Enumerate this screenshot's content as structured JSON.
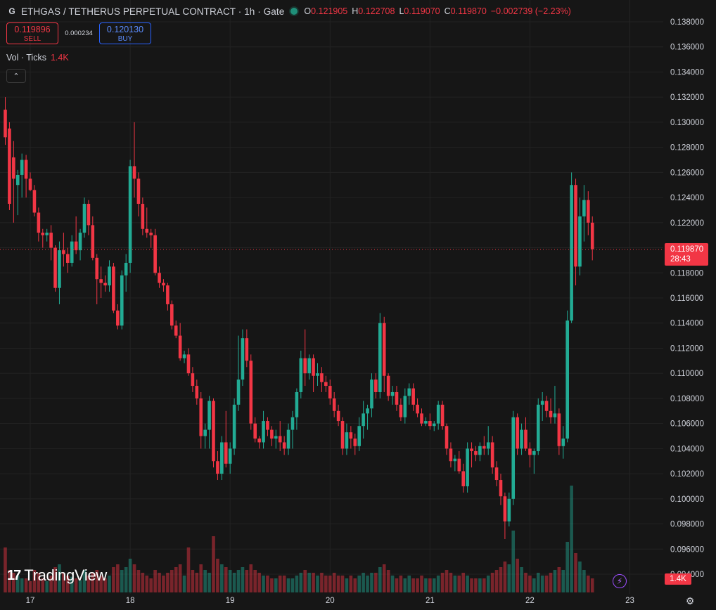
{
  "header": {
    "symbol_logo": "G",
    "title": "ETHGAS / TETHERUS PERPETUAL CONTRACT · 1h · Gate",
    "open_label": "O",
    "open": "0.121905",
    "high_label": "H",
    "high": "0.122708",
    "low_label": "L",
    "low": "0.119070",
    "close_label": "C",
    "close": "0.119870",
    "change": "−0.002739 (−2.23%)"
  },
  "trade": {
    "sell_price": "0.119896",
    "sell_label": "SELL",
    "spread": "0.000234",
    "buy_price": "0.120130",
    "buy_label": "BUY"
  },
  "volume_legend": {
    "label": "Vol · Ticks",
    "value": "1.4K"
  },
  "last_price_tag": {
    "price": "0.119870",
    "countdown": "28:43"
  },
  "volume_tag": "1.4K",
  "watermark": "TradingView",
  "colors": {
    "up": "#22ab94",
    "down": "#f23645",
    "background": "#161616",
    "grid": "#232323"
  },
  "icons": [
    "chevron-up-icon",
    "lightning-icon",
    "settings-icon",
    "tradingview-logo-icon"
  ],
  "chart_data": {
    "type": "candlestick",
    "title": "ETHGAS / TETHERUS PERPETUAL CONTRACT · 1h · Gate",
    "y_ticks": [
      "0.138000",
      "0.136000",
      "0.134000",
      "0.132000",
      "0.130000",
      "0.128000",
      "0.126000",
      "0.124000",
      "0.122000",
      "0.120000",
      "0.118000",
      "0.116000",
      "0.114000",
      "0.112000",
      "0.110000",
      "0.108000",
      "0.106000",
      "0.104000",
      "0.102000",
      "0.100000",
      "0.098000",
      "0.096000",
      "0.094000"
    ],
    "x_ticks": [
      {
        "label": "17",
        "bar": 6
      },
      {
        "label": "18",
        "bar": 30
      },
      {
        "label": "19",
        "bar": 54
      },
      {
        "label": "20",
        "bar": 78
      },
      {
        "label": "21",
        "bar": 102
      },
      {
        "label": "22",
        "bar": 126
      },
      {
        "label": "23",
        "bar": 150
      }
    ],
    "ylim": [
      0.0935,
      0.139
    ],
    "last_price": 0.11987,
    "candles": [
      [
        0.131,
        0.132,
        0.1282,
        0.1288,
        80
      ],
      [
        0.1295,
        0.13,
        0.123,
        0.1235,
        40
      ],
      [
        0.1272,
        0.1285,
        0.122,
        0.1255,
        35
      ],
      [
        0.125,
        0.1262,
        0.1226,
        0.1258,
        30
      ],
      [
        0.1258,
        0.1275,
        0.124,
        0.127,
        25
      ],
      [
        0.127,
        0.1274,
        0.124,
        0.1255,
        25
      ],
      [
        0.1255,
        0.126,
        0.1245,
        0.1246,
        20
      ],
      [
        0.1246,
        0.125,
        0.1225,
        0.1228,
        40
      ],
      [
        0.1228,
        0.1232,
        0.1205,
        0.1212,
        35
      ],
      [
        0.1212,
        0.1215,
        0.12,
        0.121,
        25
      ],
      [
        0.121,
        0.1215,
        0.1205,
        0.1212,
        20
      ],
      [
        0.1212,
        0.1218,
        0.119,
        0.12,
        30
      ],
      [
        0.12,
        0.1202,
        0.1165,
        0.1168,
        45
      ],
      [
        0.1168,
        0.1205,
        0.1155,
        0.1198,
        50
      ],
      [
        0.1198,
        0.1212,
        0.1185,
        0.1195,
        35
      ],
      [
        0.1195,
        0.12,
        0.118,
        0.1188,
        30
      ],
      [
        0.1188,
        0.121,
        0.1185,
        0.1205,
        28
      ],
      [
        0.1205,
        0.1225,
        0.1195,
        0.1198,
        25
      ],
      [
        0.1198,
        0.1215,
        0.119,
        0.1212,
        22
      ],
      [
        0.1212,
        0.124,
        0.1208,
        0.1235,
        40
      ],
      [
        0.1235,
        0.1238,
        0.121,
        0.1218,
        30
      ],
      [
        0.1218,
        0.1225,
        0.119,
        0.1192,
        35
      ],
      [
        0.1192,
        0.1195,
        0.1155,
        0.1175,
        40
      ],
      [
        0.1175,
        0.1185,
        0.116,
        0.1172,
        30
      ],
      [
        0.1172,
        0.1178,
        0.1165,
        0.117,
        25
      ],
      [
        0.117,
        0.119,
        0.1165,
        0.1185,
        30
      ],
      [
        0.1185,
        0.1188,
        0.1148,
        0.115,
        45
      ],
      [
        0.115,
        0.1155,
        0.1135,
        0.1138,
        50
      ],
      [
        0.1138,
        0.1182,
        0.1135,
        0.1178,
        40
      ],
      [
        0.1178,
        0.1195,
        0.1165,
        0.1188,
        45
      ],
      [
        0.1188,
        0.127,
        0.118,
        0.1265,
        60
      ],
      [
        0.1265,
        0.13,
        0.124,
        0.1255,
        50
      ],
      [
        0.1255,
        0.126,
        0.1225,
        0.1235,
        40
      ],
      [
        0.1235,
        0.124,
        0.121,
        0.1215,
        35
      ],
      [
        0.1215,
        0.1232,
        0.1208,
        0.1212,
        30
      ],
      [
        0.1212,
        0.1215,
        0.12,
        0.121,
        25
      ],
      [
        0.121,
        0.1215,
        0.1178,
        0.118,
        40
      ],
      [
        0.118,
        0.1185,
        0.1168,
        0.1172,
        35
      ],
      [
        0.1172,
        0.1175,
        0.1165,
        0.117,
        30
      ],
      [
        0.117,
        0.1172,
        0.115,
        0.1155,
        35
      ],
      [
        0.1155,
        0.1158,
        0.1135,
        0.1138,
        40
      ],
      [
        0.1138,
        0.1142,
        0.1128,
        0.113,
        45
      ],
      [
        0.113,
        0.114,
        0.111,
        0.1112,
        50
      ],
      [
        0.1112,
        0.1118,
        0.1108,
        0.1115,
        30
      ],
      [
        0.1115,
        0.112,
        0.1098,
        0.11,
        80
      ],
      [
        0.11,
        0.1105,
        0.1085,
        0.109,
        40
      ],
      [
        0.109,
        0.1095,
        0.1075,
        0.108,
        35
      ],
      [
        0.108,
        0.1085,
        0.104,
        0.105,
        50
      ],
      [
        0.105,
        0.106,
        0.104,
        0.1055,
        40
      ],
      [
        0.1055,
        0.1082,
        0.104,
        0.1078,
        35
      ],
      [
        0.1078,
        0.108,
        0.1025,
        0.103,
        100
      ],
      [
        0.103,
        0.1038,
        0.1015,
        0.102,
        60
      ],
      [
        0.102,
        0.105,
        0.1015,
        0.1045,
        50
      ],
      [
        0.1045,
        0.107,
        0.1025,
        0.1028,
        45
      ],
      [
        0.1028,
        0.1045,
        0.102,
        0.104,
        40
      ],
      [
        0.104,
        0.108,
        0.1035,
        0.1075,
        35
      ],
      [
        0.1075,
        0.113,
        0.107,
        0.1095,
        40
      ],
      [
        0.1095,
        0.1135,
        0.109,
        0.1128,
        45
      ],
      [
        0.1128,
        0.1135,
        0.1105,
        0.111,
        40
      ],
      [
        0.111,
        0.1115,
        0.1055,
        0.106,
        50
      ],
      [
        0.106,
        0.1065,
        0.1045,
        0.1048,
        40
      ],
      [
        0.1048,
        0.105,
        0.104,
        0.1045,
        35
      ],
      [
        0.1045,
        0.107,
        0.104,
        0.1062,
        30
      ],
      [
        0.1062,
        0.1065,
        0.105,
        0.1055,
        30
      ],
      [
        0.1055,
        0.1058,
        0.1042,
        0.1048,
        25
      ],
      [
        0.1048,
        0.1055,
        0.104,
        0.105,
        25
      ],
      [
        0.105,
        0.1062,
        0.1038,
        0.1045,
        30
      ],
      [
        0.1045,
        0.105,
        0.1035,
        0.104,
        30
      ],
      [
        0.104,
        0.106,
        0.1035,
        0.1055,
        25
      ],
      [
        0.1055,
        0.107,
        0.104,
        0.1065,
        25
      ],
      [
        0.1065,
        0.1088,
        0.1055,
        0.1085,
        30
      ],
      [
        0.1085,
        0.1118,
        0.108,
        0.1112,
        35
      ],
      [
        0.1112,
        0.1135,
        0.109,
        0.11,
        40
      ],
      [
        0.11,
        0.1115,
        0.1095,
        0.1112,
        35
      ],
      [
        0.1112,
        0.1115,
        0.1085,
        0.1098,
        35
      ],
      [
        0.1098,
        0.1108,
        0.109,
        0.11,
        30
      ],
      [
        0.11,
        0.1105,
        0.1085,
        0.1093,
        35
      ],
      [
        0.1093,
        0.1098,
        0.1085,
        0.109,
        30
      ],
      [
        0.109,
        0.1095,
        0.1075,
        0.108,
        30
      ],
      [
        0.108,
        0.1085,
        0.1065,
        0.107,
        35
      ],
      [
        0.107,
        0.1075,
        0.1058,
        0.1062,
        30
      ],
      [
        0.1062,
        0.1065,
        0.1035,
        0.104,
        30
      ],
      [
        0.104,
        0.106,
        0.1035,
        0.1053,
        25
      ],
      [
        0.1053,
        0.1058,
        0.104,
        0.1048,
        30
      ],
      [
        0.1048,
        0.1052,
        0.1035,
        0.1042,
        25
      ],
      [
        0.1042,
        0.1065,
        0.1038,
        0.1058,
        30
      ],
      [
        0.1058,
        0.1078,
        0.1048,
        0.1068,
        35
      ],
      [
        0.1068,
        0.1075,
        0.1055,
        0.1072,
        30
      ],
      [
        0.1072,
        0.11,
        0.1065,
        0.1095,
        35
      ],
      [
        0.1095,
        0.11,
        0.108,
        0.1085,
        35
      ],
      [
        0.1085,
        0.1148,
        0.108,
        0.114,
        45
      ],
      [
        0.114,
        0.1145,
        0.1085,
        0.1098,
        50
      ],
      [
        0.1098,
        0.11,
        0.1078,
        0.1082,
        40
      ],
      [
        0.1082,
        0.109,
        0.1075,
        0.1085,
        30
      ],
      [
        0.1085,
        0.109,
        0.107,
        0.1075,
        25
      ],
      [
        0.1075,
        0.108,
        0.1062,
        0.1065,
        30
      ],
      [
        0.1065,
        0.1088,
        0.106,
        0.1082,
        25
      ],
      [
        0.1082,
        0.1092,
        0.1075,
        0.1088,
        30
      ],
      [
        0.1088,
        0.1092,
        0.107,
        0.1075,
        25
      ],
      [
        0.1075,
        0.108,
        0.1065,
        0.1068,
        25
      ],
      [
        0.1068,
        0.1072,
        0.1058,
        0.106,
        30
      ],
      [
        0.106,
        0.1065,
        0.1058,
        0.1062,
        25
      ],
      [
        0.1062,
        0.1068,
        0.1055,
        0.1058,
        25
      ],
      [
        0.1058,
        0.1062,
        0.1054,
        0.106,
        25
      ],
      [
        0.106,
        0.1078,
        0.1055,
        0.1075,
        30
      ],
      [
        0.1075,
        0.1078,
        0.1055,
        0.1058,
        35
      ],
      [
        0.1058,
        0.106,
        0.1035,
        0.104,
        40
      ],
      [
        0.104,
        0.1045,
        0.1025,
        0.103,
        35
      ],
      [
        0.103,
        0.1035,
        0.1022,
        0.1032,
        30
      ],
      [
        0.1032,
        0.1038,
        0.102,
        0.1022,
        30
      ],
      [
        0.1022,
        0.1028,
        0.1005,
        0.101,
        35
      ],
      [
        0.101,
        0.1045,
        0.1005,
        0.104,
        30
      ],
      [
        0.104,
        0.1045,
        0.1025,
        0.1038,
        25
      ],
      [
        0.1038,
        0.1042,
        0.103,
        0.1035,
        25
      ],
      [
        0.1035,
        0.1045,
        0.103,
        0.1042,
        25
      ],
      [
        0.1042,
        0.105,
        0.1035,
        0.104,
        25
      ],
      [
        0.104,
        0.1058,
        0.1035,
        0.1045,
        30
      ],
      [
        0.1045,
        0.105,
        0.102,
        0.1025,
        35
      ],
      [
        0.1025,
        0.103,
        0.101,
        0.1015,
        40
      ],
      [
        0.1015,
        0.102,
        0.0995,
        0.1002,
        45
      ],
      [
        0.1002,
        0.1005,
        0.0968,
        0.0982,
        55
      ],
      [
        0.0982,
        0.1005,
        0.0978,
        0.1,
        50
      ],
      [
        0.1,
        0.107,
        0.0995,
        0.1065,
        110
      ],
      [
        0.1065,
        0.1068,
        0.1035,
        0.104,
        60
      ],
      [
        0.104,
        0.106,
        0.1035,
        0.1055,
        45
      ],
      [
        0.1055,
        0.1065,
        0.1038,
        0.104,
        35
      ],
      [
        0.104,
        0.1045,
        0.1025,
        0.1035,
        30
      ],
      [
        0.1035,
        0.104,
        0.102,
        0.1038,
        25
      ],
      [
        0.1038,
        0.108,
        0.1035,
        0.1075,
        35
      ],
      [
        0.1075,
        0.1085,
        0.1062,
        0.1078,
        30
      ],
      [
        0.1078,
        0.1082,
        0.1065,
        0.107,
        30
      ],
      [
        0.107,
        0.108,
        0.106,
        0.1065,
        35
      ],
      [
        0.1065,
        0.109,
        0.106,
        0.1068,
        40
      ],
      [
        0.1068,
        0.1072,
        0.1035,
        0.1042,
        45
      ],
      [
        0.1042,
        0.1058,
        0.1032,
        0.1048,
        40
      ],
      [
        0.1048,
        0.115,
        0.1045,
        0.1142,
        90
      ],
      [
        0.1142,
        0.126,
        0.114,
        0.125,
        190
      ],
      [
        0.125,
        0.1255,
        0.117,
        0.1185,
        70
      ],
      [
        0.1185,
        0.124,
        0.1178,
        0.1225,
        55
      ],
      [
        0.1225,
        0.125,
        0.1205,
        0.1238,
        40
      ],
      [
        0.1238,
        0.1245,
        0.121,
        0.122,
        30
      ],
      [
        0.122,
        0.1225,
        0.119,
        0.1199,
        25
      ]
    ]
  }
}
